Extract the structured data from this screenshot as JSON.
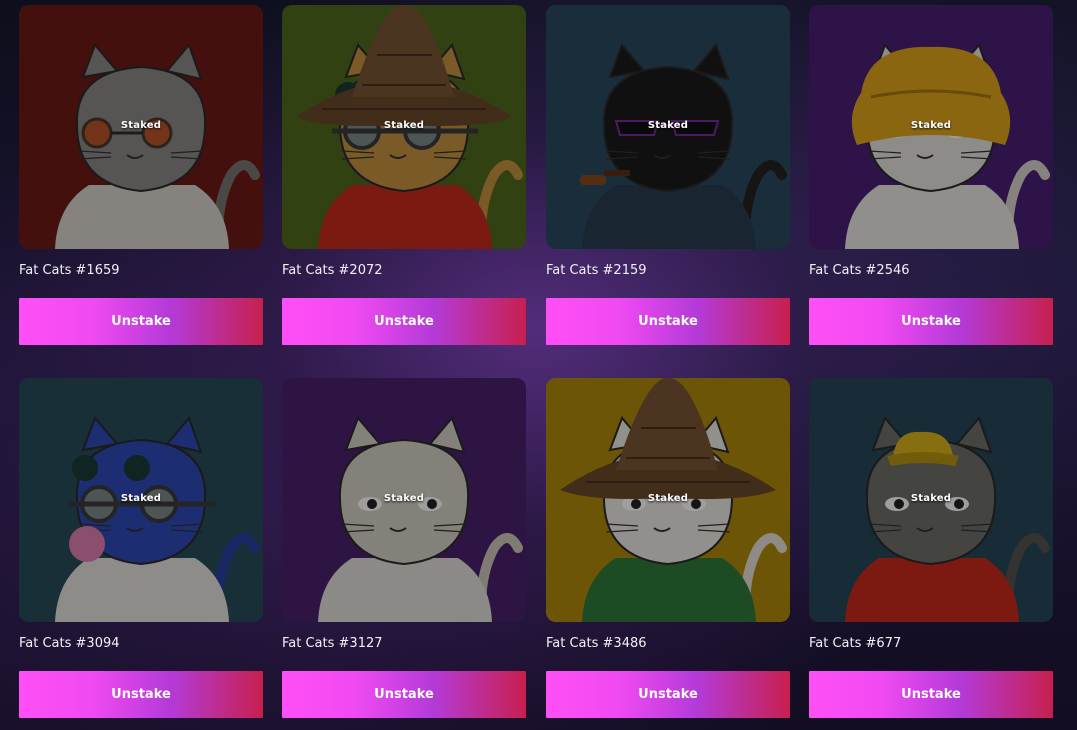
{
  "cards": [
    {
      "name": "Fat Cats #1659",
      "badge": "Staked",
      "action": "Unstake",
      "bg": "#6e1b17",
      "fur": "#8b8a86",
      "accent": "#c44b1a",
      "hat": "none",
      "glasses": "round-orange",
      "shirt": "#d8d4cc",
      "tail": "#7a7772"
    },
    {
      "name": "Fat Cats #2072",
      "badge": "Staked",
      "action": "Unstake",
      "bg": "#4f6a1d",
      "fur": "#c6913f",
      "accent": "#c22d22",
      "hat": "straw",
      "glasses": "goggles",
      "shirt": "#c72a1f",
      "tail": "#c6913f"
    },
    {
      "name": "Fat Cats #2159",
      "badge": "Staked",
      "action": "Unstake",
      "bg": "#2b4a5f",
      "fur": "#1a1a1a",
      "accent": "#7a2aa0",
      "hat": "none",
      "glasses": "shades",
      "shirt": "#2a3d52",
      "tail": "#222"
    },
    {
      "name": "Fat Cats #2546",
      "badge": "Staked",
      "action": "Unstake",
      "bg": "#4a1f74",
      "fur": "#e6e3de",
      "accent": "#e0a51c",
      "hat": "bucket-yellow",
      "glasses": "none",
      "shirt": "#ebe7e1",
      "tail": "#d9d4cc"
    },
    {
      "name": "Fat Cats #3094",
      "badge": "Staked",
      "action": "Unstake",
      "bg": "#274c5b",
      "fur": "#2f49b8",
      "accent": "#e07fae",
      "hat": "none",
      "glasses": "goggles",
      "shirt": "#e6e2dd",
      "tail": "#2a3fa4"
    },
    {
      "name": "Fat Cats #3127",
      "badge": "Staked",
      "action": "Unstake",
      "bg": "#4b216c",
      "fur": "#d6d0c6",
      "accent": "#aaa",
      "hat": "none",
      "glasses": "none",
      "shirt": "#e3dfd9",
      "tail": "#cfc8bc"
    },
    {
      "name": "Fat Cats #3486",
      "badge": "Staked",
      "action": "Unstake",
      "bg": "#b08a0c",
      "fur": "#ece9e4",
      "accent": "#2f7a3b",
      "hat": "straw",
      "glasses": "none",
      "shirt": "#2f7a3b",
      "tail": "#e6e1da"
    },
    {
      "name": "Fat Cats #677",
      "badge": "Staked",
      "action": "Unstake",
      "bg": "#264858",
      "fur": "#6f6e6a",
      "accent": "#d8b21c",
      "hat": "bucket-small",
      "glasses": "none",
      "shirt": "#c92a1e",
      "tail": "#55534f"
    }
  ]
}
